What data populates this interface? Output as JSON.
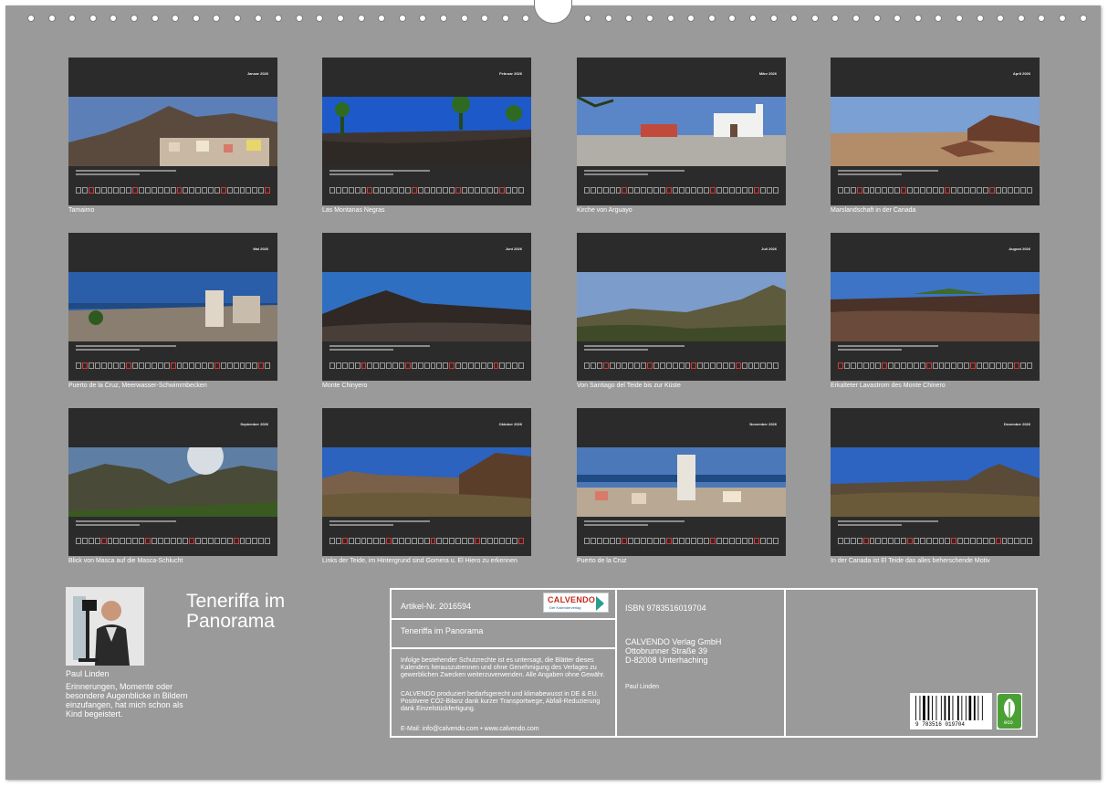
{
  "months": [
    {
      "month": "Januar 2026",
      "label": "Tamaimo",
      "red": [
        3,
        10,
        17,
        24,
        31
      ],
      "scene": "mountain-town"
    },
    {
      "month": "Februar 2026",
      "label": "Las Montanas Negras",
      "red": [
        7,
        14,
        21,
        28
      ],
      "scene": "black-mountains"
    },
    {
      "month": "März 2026",
      "label": "Kirche von Arguayo",
      "red": [
        7,
        14,
        21,
        28
      ],
      "scene": "church"
    },
    {
      "month": "April 2026",
      "label": "Marslandschaft in der Canada",
      "red": [
        4,
        11,
        18,
        25
      ],
      "scene": "mars"
    },
    {
      "month": "Mai 2026",
      "label": "Puerto de la Cruz, Meerwasser-Schwimmbecken",
      "red": [
        2,
        9,
        16,
        23,
        30
      ],
      "scene": "coast-town"
    },
    {
      "month": "Juni 2026",
      "label": "Monte Chinyero",
      "red": [
        6,
        13,
        20,
        27
      ],
      "scene": "volcano"
    },
    {
      "month": "Juli 2026",
      "label": "Von Santiago del Teide bis zur Küste",
      "red": [
        4,
        11,
        18,
        25
      ],
      "scene": "valley"
    },
    {
      "month": "August 2026",
      "label": "Erkalteter Lavastrom des Monte Chinero",
      "red": [
        1,
        8,
        15,
        22,
        29
      ],
      "scene": "lava"
    },
    {
      "month": "September 2026",
      "label": "Blick von Masca auf die Masca-Schlucht",
      "red": [
        5,
        12,
        19,
        26
      ],
      "scene": "masca"
    },
    {
      "month": "Oktober 2026",
      "label": "Links der Teide, im Hintergrund sind Gomera u. El Hiero zu erkennen",
      "red": [
        3,
        10,
        17,
        24,
        31
      ],
      "scene": "teide-view"
    },
    {
      "month": "November 2026",
      "label": "Puerto de la Cruz",
      "red": [
        7,
        14,
        21,
        28
      ],
      "scene": "city"
    },
    {
      "month": "Dezember 2026",
      "label": "In der Canada ist El Teide das alles beherschende Motiv",
      "red": [
        5,
        12,
        19,
        26
      ],
      "scene": "teide"
    }
  ],
  "author": {
    "name": "Paul Linden",
    "bio": "Erinnerungen, Momente oder besondere Augenblicke in Bildern einzufangen, hat mich schon als Kind begeistert."
  },
  "title": "Teneriffa im Panorama",
  "info": {
    "article": "Artikel-Nr. 2016594",
    "logo_name": "CALVENDO",
    "logo_sub": "Der Kalenderverlag",
    "product_title": "Teneriffa im Panorama",
    "copyright": "Infolge bestehender Schutzrechte ist es untersagt, die Blätter dieses Kalenders herauszutrennen und ohne Genehmigung des Verlages zu gewerblichen Zwecken weiterzuverwenden. Alle Angaben ohne Gewähr.",
    "climate": "CALVENDO produziert bedarfsgerecht und klimabewusst in DE & EU. Positivere CO2-Bilanz dank kurzer Transportwege, Abfall-Reduzierung dank Einzelstückfertigung.",
    "contact": "E-Mail: info@calvendo.com • www.calvendo.com",
    "isbn": "ISBN 9783516019704",
    "publisher_name": "CALVENDO Verlag GmbH",
    "publisher_street": "Ottobrunner Straße 39",
    "publisher_city": "D-82008 Unterhaching",
    "author_name": "Paul Linden",
    "barcode_text": "9 783516 019704",
    "eco_label": "eco"
  }
}
